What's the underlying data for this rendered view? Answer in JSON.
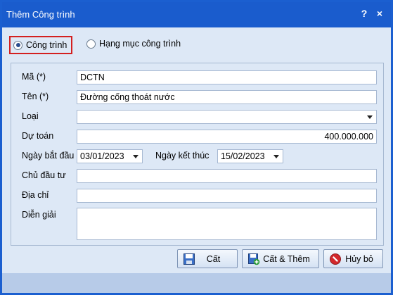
{
  "window": {
    "title": "Thêm Công trình",
    "help_symbol": "?",
    "close_symbol": "×"
  },
  "radio": [
    {
      "label": "Công trình",
      "selected": true
    },
    {
      "label": "Hạng mục công trình",
      "selected": false
    }
  ],
  "form": {
    "ma": {
      "label": "Mã (*)",
      "value": "DCTN"
    },
    "ten": {
      "label": "Tên (*)",
      "value": "Đường cống thoát nước"
    },
    "loai": {
      "label": "Loại",
      "value": ""
    },
    "du_toan": {
      "label": "Dự toán",
      "value": "400.000.000"
    },
    "ngay_bat_dau": {
      "label": "Ngày bắt đầu",
      "value": "03/01/2023"
    },
    "ngay_ket_thuc": {
      "label": "Ngày kết thúc",
      "value": "15/02/2023"
    },
    "chu_dau_tu": {
      "label": "Chủ đầu tư",
      "value": ""
    },
    "dia_chi": {
      "label": "Địa chỉ",
      "value": ""
    },
    "dien_giai": {
      "label": "Diễn giải",
      "value": ""
    }
  },
  "buttons": {
    "save": {
      "label": "Cất",
      "icon": "floppy-disk-icon"
    },
    "save_add": {
      "label": "Cất & Thêm",
      "icon": "save-add-icon"
    },
    "cancel": {
      "label": "Hủy bỏ",
      "icon": "cancel-icon"
    }
  },
  "colors": {
    "titlebar": "#1a5ccd",
    "highlight_border": "#d42020",
    "background": "#dde8f6"
  }
}
